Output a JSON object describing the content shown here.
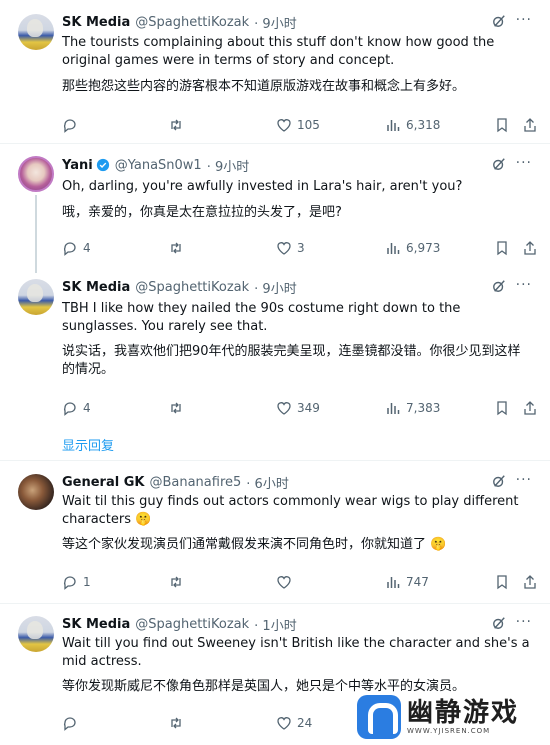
{
  "tweets": [
    {
      "name": "SK Media",
      "handle": "@SpaghettiKozak",
      "time": "· 9小时",
      "text_en": "The tourists complaining about this stuff don't know how good the original games were in terms of story and concept.",
      "text_zh": "那些抱怨这些内容的游客根本不知道原版游戏在故事和概念上有多好。",
      "replies": "",
      "likes": "105",
      "views": "6,318"
    },
    {
      "name": "Yani",
      "handle": "@YanaSn0w1",
      "time": "· 9小时",
      "text_en": "Oh, darling, you're awfully invested in Lara's hair, aren't you?",
      "text_zh": "哦，亲爱的，你真是太在意拉拉的头发了，是吧?",
      "replies": "4",
      "likes": "3",
      "views": "6,973"
    },
    {
      "name": "SK Media",
      "handle": "@SpaghettiKozak",
      "time": "· 9小时",
      "text_en": "TBH I like how they nailed the 90s costume right down to the sunglasses. You rarely see that.",
      "text_zh": "说实话，我喜欢他们把90年代的服装完美呈现，连墨镜都没错。你很少见到这样的情况。",
      "replies": "4",
      "likes": "349",
      "views": "7,383"
    },
    {
      "name": "General GK",
      "handle": "@Bananafire5",
      "time": "· 6小时",
      "text_en": "Wait til this guy finds out actors commonly wear wigs to play different characters 🤫",
      "text_zh": "等这个家伙发现演员们通常戴假发来演不同角色时，你就知道了 🤫",
      "replies": "1",
      "likes": "",
      "views": "747"
    },
    {
      "name": "SK Media",
      "handle": "@SpaghettiKozak",
      "time": "· 1小时",
      "text_en": "Wait till you find out Sweeney isn't British like the character and she's a mid actress.",
      "text_zh": "等你发现斯威尼不像角色那样是英国人，她只是个中等水平的女演员。",
      "replies": "",
      "likes": "24",
      "views": ""
    }
  ],
  "show_replies": "显示回复",
  "more_label": "···",
  "watermark": {
    "title": "幽静游戏",
    "url": "WWW.YJISREN.COM"
  },
  "colors": {
    "accent": "#1d9bf0",
    "muted": "#536471",
    "divider": "#eff3f4"
  }
}
